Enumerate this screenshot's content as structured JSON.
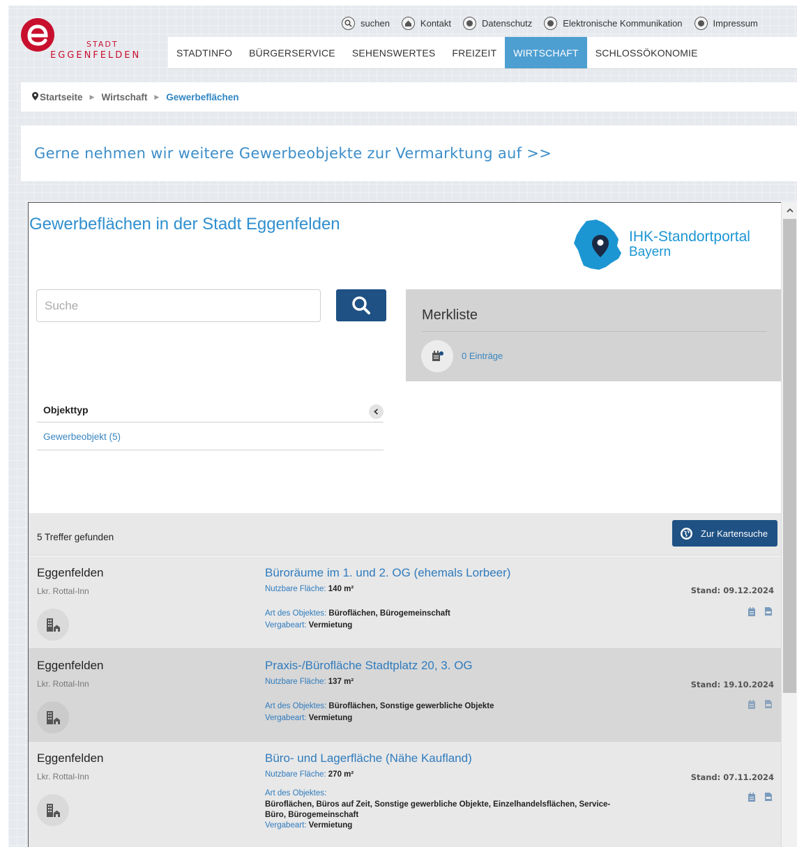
{
  "logo": {
    "stadt": "STADT",
    "name": "EGGENFELDEN"
  },
  "utility": [
    {
      "label": "suchen",
      "icon": "search-icon"
    },
    {
      "label": "Kontakt",
      "icon": "home-icon"
    },
    {
      "label": "Datenschutz",
      "icon": "info-icon"
    },
    {
      "label": "Elektronische Kommunikation",
      "icon": "info-icon"
    },
    {
      "label": "Impressum",
      "icon": "info-icon"
    }
  ],
  "nav": [
    "STADTINFO",
    "BÜRGERSERVICE",
    "SEHENSWERTES",
    "FREIZEIT",
    "WIRTSCHAFT",
    "SCHLOSSÖKONOMIE"
  ],
  "nav_active": "WIRTSCHAFT",
  "breadcrumb": [
    "Startseite",
    "Wirtschaft",
    "Gewerbeflächen"
  ],
  "promo": "Gerne nehmen wir weitere Gewerbeobjekte zur Vermarktung auf >>",
  "portal": {
    "title": "Gewerbeflächen in der Stadt Eggenfelden",
    "ihk_line1": "IHK-Standortportal",
    "ihk_line2": "Bayern",
    "search_placeholder": "Suche",
    "merkliste_title": "Merkliste",
    "merkliste_count": "0 Einträge",
    "facet_title": "Objekttyp",
    "facet_item": "Gewerbeobjekt (5)",
    "results_count": "5 Treffer gefunden",
    "map_button": "Zur Kartensuche"
  },
  "results": [
    {
      "city": "Eggenfelden",
      "district": "Lkr. Rottal-Inn",
      "title": "Büroräume im 1. und 2. OG (ehemals Lorbeer)",
      "area_label": "Nutzbare Fläche:",
      "area_value": "140 m²",
      "art_label": "Art des Objektes:",
      "art_value": "Büroflächen, Bürogemeinschaft",
      "vergabe_label": "Vergabeart:",
      "vergabe_value": "Vermietung",
      "stand": "Stand: 09.12.2024"
    },
    {
      "city": "Eggenfelden",
      "district": "Lkr. Rottal-Inn",
      "title": "Praxis-/Bürofläche Stadtplatz 20, 3. OG",
      "area_label": "Nutzbare Fläche:",
      "area_value": "137 m²",
      "art_label": "Art des Objektes:",
      "art_value": "Büroflächen, Sonstige gewerbliche Objekte",
      "vergabe_label": "Vergabeart:",
      "vergabe_value": "Vermietung",
      "stand": "Stand: 19.10.2024"
    },
    {
      "city": "Eggenfelden",
      "district": "Lkr. Rottal-Inn",
      "title": "Büro- und Lagerfläche (Nähe Kaufland)",
      "area_label": "Nutzbare Fläche:",
      "area_value": "270 m²",
      "art_label": "Art des Objektes:",
      "art_value_1": "Büroflächen, Büros auf Zeit, Sonstige gewerbliche Objekte, Einzelhandelsflächen, Service-",
      "art_value_2": "Büro, Bürogemeinschaft",
      "vergabe_label": "Vergabeart:",
      "vergabe_value": "Vermietung",
      "stand": "Stand: 07.11.2024"
    }
  ],
  "colors": {
    "accent": "#4d9ed1",
    "brand": "#c8102e",
    "button": "#1f5184",
    "link": "#2f7bbd"
  }
}
